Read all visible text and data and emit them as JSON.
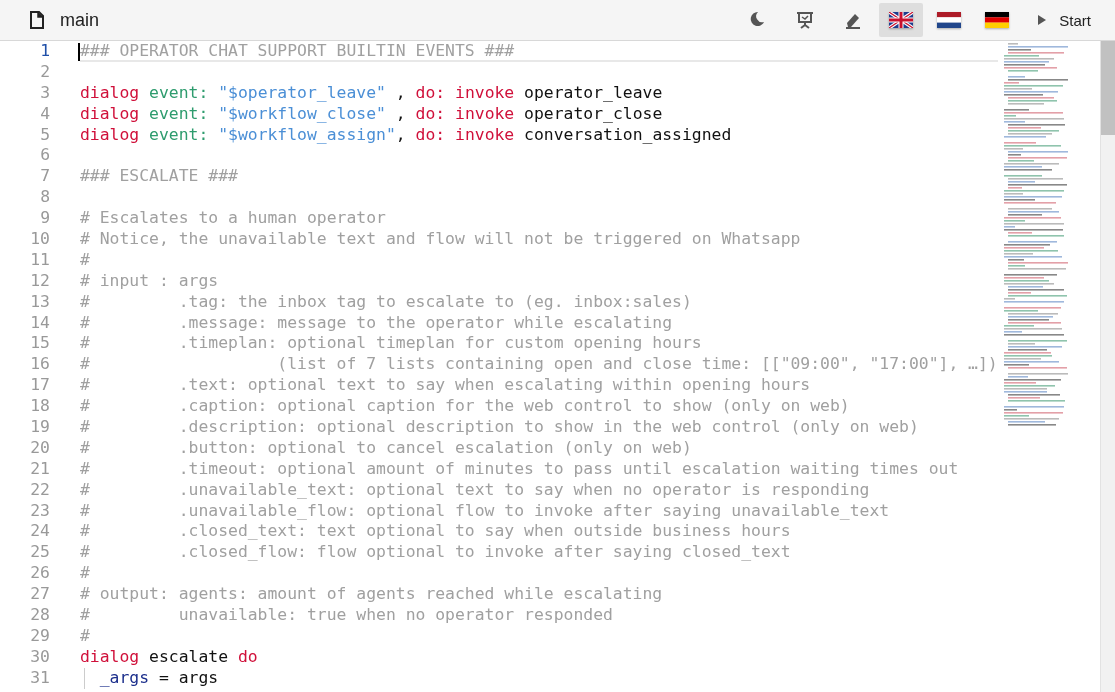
{
  "toolbar": {
    "file_name": "main",
    "tools": [
      {
        "kind": "moon"
      },
      {
        "kind": "presentation"
      },
      {
        "kind": "eraser"
      }
    ],
    "languages": [
      {
        "kind": "uk",
        "selected": true
      },
      {
        "kind": "nl",
        "selected": false
      },
      {
        "kind": "de",
        "selected": false
      }
    ],
    "start_button": "Start"
  },
  "editor": {
    "lines": [
      {
        "number": "1",
        "current": true,
        "tokens": [
          {
            "kind": "comment",
            "text": "### OPERATOR CHAT SUPPORT BUILTIN EVENTS ###"
          }
        ]
      },
      {
        "number": "2",
        "current": false
      },
      {
        "number": "3",
        "current": false,
        "tokens": [
          {
            "kind": "keyword",
            "text": "dialog"
          },
          {
            "kind": "attr",
            "text": " event:"
          },
          {
            "kind": "string",
            "text": " \"$operator_leave\""
          },
          {
            "kind": "plain",
            "text": " ,"
          },
          {
            "kind": "keyword",
            "text": " do:"
          },
          {
            "kind": "keyword",
            "text": " invoke"
          },
          {
            "kind": "plain",
            "text": " operator_leave"
          }
        ]
      },
      {
        "number": "4",
        "current": false,
        "tokens": [
          {
            "kind": "keyword",
            "text": "dialog"
          },
          {
            "kind": "attr",
            "text": " event:"
          },
          {
            "kind": "string",
            "text": " \"$workflow_close\""
          },
          {
            "kind": "plain",
            "text": " ,"
          },
          {
            "kind": "keyword",
            "text": " do:"
          },
          {
            "kind": "keyword",
            "text": " invoke"
          },
          {
            "kind": "plain",
            "text": " operator_close"
          }
        ]
      },
      {
        "number": "5",
        "current": false,
        "tokens": [
          {
            "kind": "keyword",
            "text": "dialog"
          },
          {
            "kind": "attr",
            "text": " event:"
          },
          {
            "kind": "string",
            "text": " \"$workflow_assign\""
          },
          {
            "kind": "plain",
            "text": ","
          },
          {
            "kind": "keyword",
            "text": " do:"
          },
          {
            "kind": "keyword",
            "text": " invoke"
          },
          {
            "kind": "plain",
            "text": " conversation_assigned"
          }
        ]
      },
      {
        "number": "6",
        "current": false
      },
      {
        "number": "7",
        "current": false,
        "tokens": [
          {
            "kind": "comment",
            "text": "### ESCALATE ###"
          }
        ]
      },
      {
        "number": "8",
        "current": false
      },
      {
        "number": "9",
        "current": false,
        "tokens": [
          {
            "kind": "comment",
            "text": "# Escalates to a human operator"
          }
        ]
      },
      {
        "number": "10",
        "current": false,
        "tokens": [
          {
            "kind": "comment",
            "text": "# Notice, the unavailable text and flow will not be triggered on Whatsapp"
          }
        ]
      },
      {
        "number": "11",
        "current": false,
        "tokens": [
          {
            "kind": "comment",
            "text": "#"
          }
        ]
      },
      {
        "number": "12",
        "current": false,
        "tokens": [
          {
            "kind": "comment",
            "text": "# input : args"
          }
        ]
      },
      {
        "number": "13",
        "current": false,
        "tokens": [
          {
            "kind": "comment",
            "text": "#         .tag: the inbox tag to escalate to (eg. inbox:sales)"
          }
        ]
      },
      {
        "number": "14",
        "current": false,
        "tokens": [
          {
            "kind": "comment",
            "text": "#         .message: message to the operator while escalating"
          }
        ]
      },
      {
        "number": "15",
        "current": false,
        "tokens": [
          {
            "kind": "comment",
            "text": "#         .timeplan: optional timeplan for custom opening hours"
          }
        ]
      },
      {
        "number": "16",
        "current": false,
        "tokens": [
          {
            "kind": "comment",
            "text": "#                   (list of 7 lists containing open and close time: [[\"09:00\", \"17:00\"], …])"
          }
        ]
      },
      {
        "number": "17",
        "current": false,
        "tokens": [
          {
            "kind": "comment",
            "text": "#         .text: optional text to say when escalating within opening hours"
          }
        ]
      },
      {
        "number": "18",
        "current": false,
        "tokens": [
          {
            "kind": "comment",
            "text": "#         .caption: optional caption for the web control to show (only on web)"
          }
        ]
      },
      {
        "number": "19",
        "current": false,
        "tokens": [
          {
            "kind": "comment",
            "text": "#         .description: optional description to show in the web control (only on web)"
          }
        ]
      },
      {
        "number": "20",
        "current": false,
        "tokens": [
          {
            "kind": "comment",
            "text": "#         .button: optional to cancel escalation (only on web)"
          }
        ]
      },
      {
        "number": "21",
        "current": false,
        "tokens": [
          {
            "kind": "comment",
            "text": "#         .timeout: optional amount of minutes to pass until escalation waiting times out"
          }
        ]
      },
      {
        "number": "22",
        "current": false,
        "tokens": [
          {
            "kind": "comment",
            "text": "#         .unavailable_text: optional text to say when no operator is responding"
          }
        ]
      },
      {
        "number": "23",
        "current": false,
        "tokens": [
          {
            "kind": "comment",
            "text": "#         .unavailable_flow: optional flow to invoke after saying unavailable_text"
          }
        ]
      },
      {
        "number": "24",
        "current": false,
        "tokens": [
          {
            "kind": "comment",
            "text": "#         .closed_text: text optional to say when outside business hours"
          }
        ]
      },
      {
        "number": "25",
        "current": false,
        "tokens": [
          {
            "kind": "comment",
            "text": "#         .closed_flow: flow optional to invoke after saying closed_text"
          }
        ]
      },
      {
        "number": "26",
        "current": false,
        "tokens": [
          {
            "kind": "comment",
            "text": "#"
          }
        ]
      },
      {
        "number": "27",
        "current": false,
        "tokens": [
          {
            "kind": "comment",
            "text": "# output: agents: amount of agents reached while escalating"
          }
        ]
      },
      {
        "number": "28",
        "current": false,
        "tokens": [
          {
            "kind": "comment",
            "text": "#         unavailable: true when no operator responded"
          }
        ]
      },
      {
        "number": "29",
        "current": false,
        "tokens": [
          {
            "kind": "comment",
            "text": "#"
          }
        ]
      },
      {
        "number": "30",
        "current": false,
        "tokens": [
          {
            "kind": "keyword",
            "text": "dialog"
          },
          {
            "kind": "plain",
            "text": " escalate"
          },
          {
            "kind": "keyword",
            "text": " do"
          }
        ]
      },
      {
        "number": "31",
        "current": false,
        "indent_guide": true,
        "tokens": [
          {
            "kind": "var",
            "text": "_args"
          },
          {
            "kind": "plain",
            "text": " = args"
          }
        ]
      }
    ]
  }
}
